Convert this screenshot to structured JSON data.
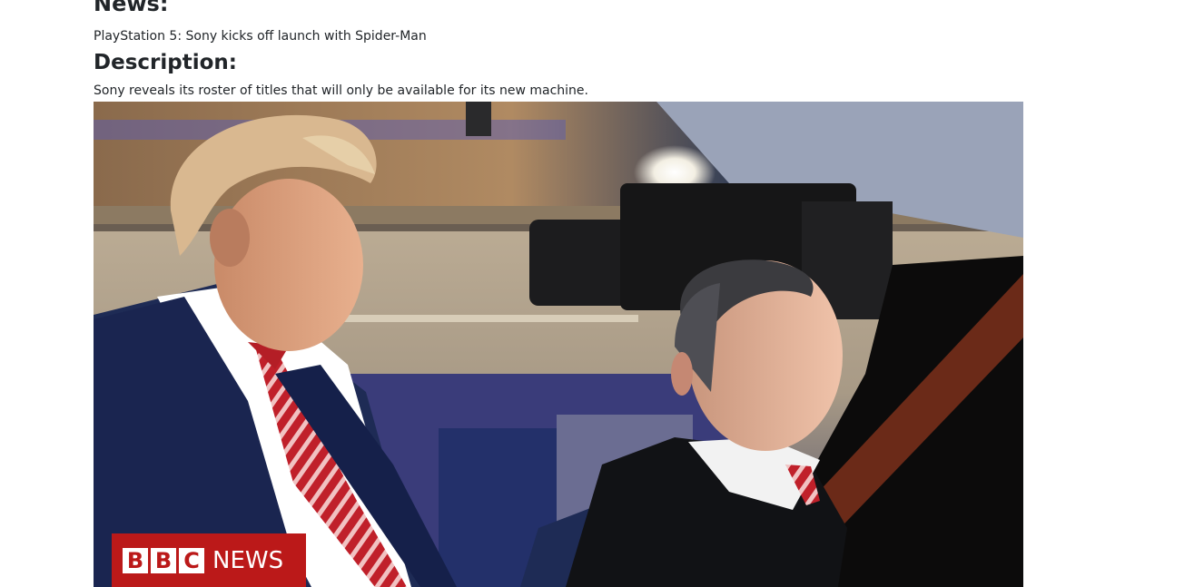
{
  "news_heading": "News:",
  "news_title": "PlayStation 5: Sony kicks off launch with Spider-Man",
  "description_heading": "Description:",
  "description_text": "Sony reveals its roster of titles that will only be available for its new machine.",
  "image": {
    "logo": {
      "letters": [
        "B",
        "B",
        "C"
      ],
      "word": "NEWS",
      "color": "#bb1919"
    }
  }
}
